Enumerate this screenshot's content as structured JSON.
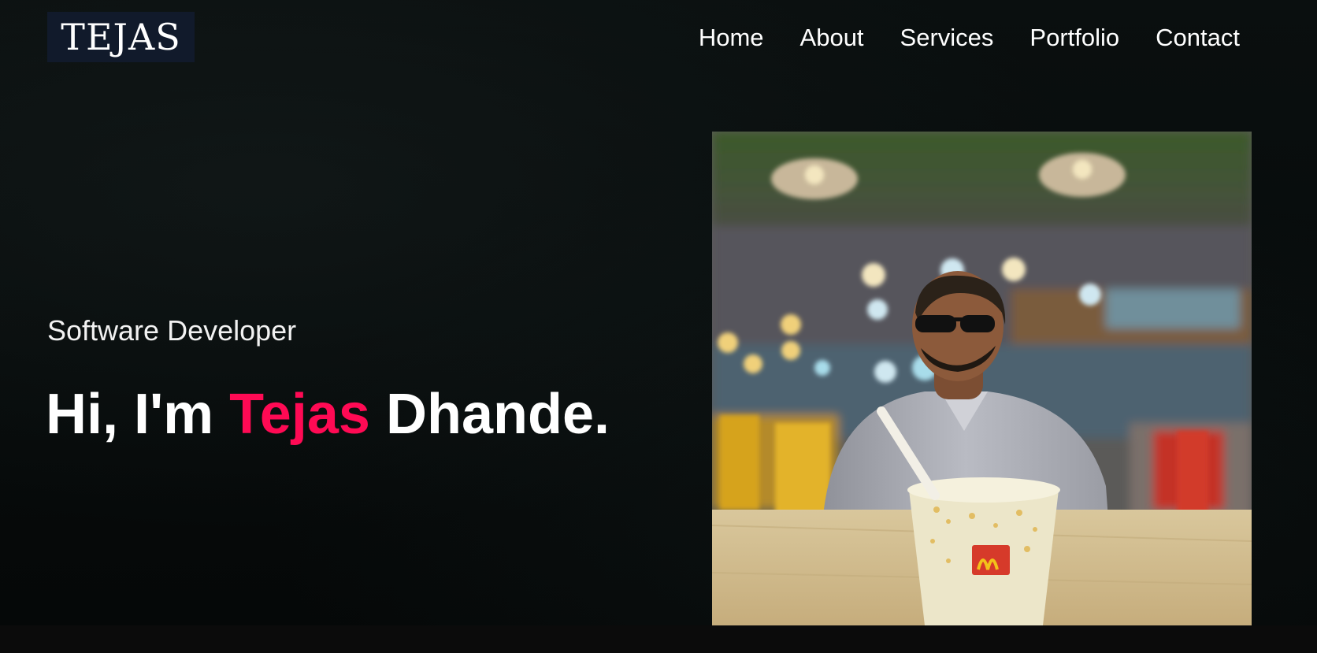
{
  "brand": {
    "logo_text": "TEJAS"
  },
  "nav": {
    "items": [
      {
        "label": "Home"
      },
      {
        "label": "About"
      },
      {
        "label": "Services"
      },
      {
        "label": "Portfolio"
      },
      {
        "label": "Contact"
      }
    ]
  },
  "hero": {
    "subtitle": "Software Developer",
    "greeting_prefix": "Hi, I'm",
    "first_name": "Tejas",
    "last_name": "Dhande.",
    "photo_alt": "Portrait photo"
  },
  "colors": {
    "accent": "#ff0a54",
    "background": "#050808",
    "logo_bg": "#111a2b"
  }
}
